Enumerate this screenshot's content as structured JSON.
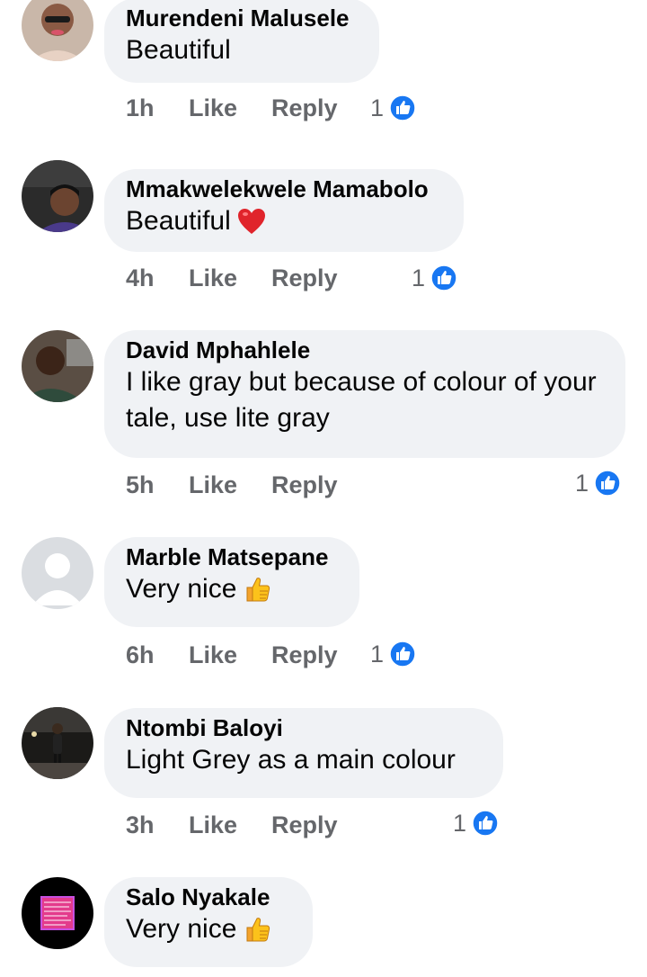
{
  "comments": [
    {
      "author": "Murendeni Malusele",
      "text": "Beautiful",
      "emoji": "",
      "time": "1h",
      "like_label": "Like",
      "reply_label": "Reply",
      "reaction_count": "1",
      "avatar_icon": "avatar-photo-icon"
    },
    {
      "author": "Mmakwelekwele Mamabolo",
      "text": "Beautiful",
      "emoji": "red-heart-emoji",
      "time": "4h",
      "like_label": "Like",
      "reply_label": "Reply",
      "reaction_count": "1",
      "avatar_icon": "avatar-photo-icon"
    },
    {
      "author": "David Mphahlele",
      "text": "I like gray but because of colour of your tale, use lite gray",
      "emoji": "",
      "time": "5h",
      "like_label": "Like",
      "reply_label": "Reply",
      "reaction_count": "1",
      "avatar_icon": "avatar-photo-icon"
    },
    {
      "author": "Marble Matsepane",
      "text": "Very nice",
      "emoji": "thumbs-up-emoji",
      "time": "6h",
      "like_label": "Like",
      "reply_label": "Reply",
      "reaction_count": "1",
      "avatar_icon": "default-avatar-icon"
    },
    {
      "author": "Ntombi Baloyi",
      "text": "Light Grey as a main colour",
      "emoji": "",
      "time": "3h",
      "like_label": "Like",
      "reply_label": "Reply",
      "reaction_count": "1",
      "avatar_icon": "avatar-photo-icon"
    },
    {
      "author": "Salo Nyakale",
      "text": "Very nice",
      "emoji": "thumbs-up-emoji",
      "avatar_icon": "avatar-photo-icon"
    }
  ],
  "colors": {
    "bubble": "#f0f2f5",
    "meta_text": "#65676b",
    "like_blue": "#1877f2"
  }
}
